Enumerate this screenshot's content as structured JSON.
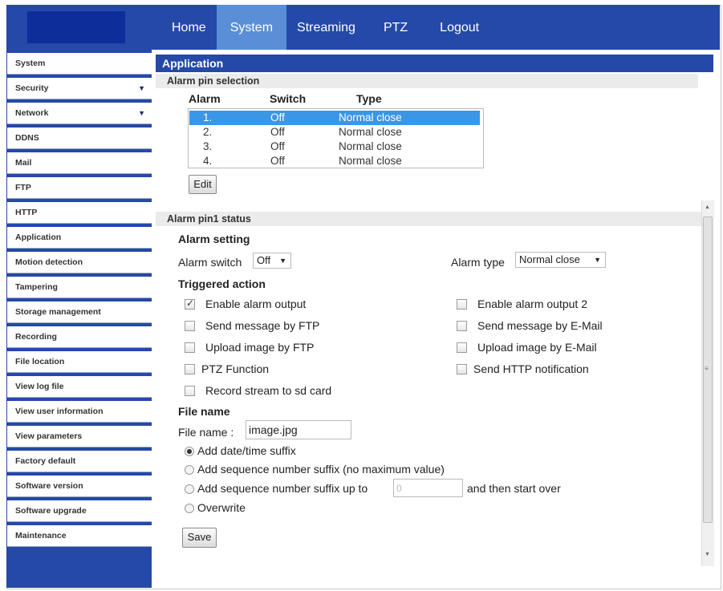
{
  "nav": {
    "items": [
      {
        "label": "Home"
      },
      {
        "label": "System"
      },
      {
        "label": "Streaming"
      },
      {
        "label": "PTZ"
      },
      {
        "label": "Logout"
      }
    ],
    "active": "System"
  },
  "sidebar": {
    "items": [
      {
        "label": "System"
      },
      {
        "label": "Security"
      },
      {
        "label": "Network"
      },
      {
        "label": "DDNS"
      },
      {
        "label": "Mail"
      },
      {
        "label": "FTP"
      },
      {
        "label": "HTTP"
      },
      {
        "label": "Application"
      },
      {
        "label": "Motion detection"
      },
      {
        "label": "Tampering"
      },
      {
        "label": "Storage management"
      },
      {
        "label": "Recording"
      },
      {
        "label": "File location"
      },
      {
        "label": "View log file"
      },
      {
        "label": "View user information"
      },
      {
        "label": "View parameters"
      },
      {
        "label": "Factory default"
      },
      {
        "label": "Software version"
      },
      {
        "label": "Software upgrade"
      },
      {
        "label": "Maintenance"
      }
    ]
  },
  "main": {
    "title": "Application",
    "alarm_pin_selection": {
      "heading": "Alarm pin selection",
      "columns": [
        "Alarm",
        "Switch",
        "Type"
      ],
      "rows": [
        {
          "alarm": "1.",
          "switch": "Off",
          "type": "Normal close"
        },
        {
          "alarm": "2.",
          "switch": "Off",
          "type": "Normal close"
        },
        {
          "alarm": "3.",
          "switch": "Off",
          "type": "Normal close"
        },
        {
          "alarm": "4.",
          "switch": "Off",
          "type": "Normal close"
        }
      ],
      "selected_row": "1.",
      "edit_label": "Edit"
    },
    "status": {
      "heading": "Alarm pin1 status",
      "alarm_setting": "Alarm setting",
      "alarm_switch_label": "Alarm switch",
      "alarm_switch_value": "Off",
      "alarm_type_label": "Alarm type",
      "alarm_type_value": "Normal close",
      "triggered_action": "Triggered action",
      "actions": {
        "enable_alarm_output": {
          "label": "Enable alarm output",
          "checked": true
        },
        "enable_alarm_output_2": {
          "label": "Enable alarm output 2",
          "checked": false
        },
        "send_ftp": {
          "label": "Send message by FTP",
          "checked": false
        },
        "send_email": {
          "label": "Send message by E-Mail",
          "checked": false
        },
        "upload_ftp": {
          "label": "Upload image by FTP",
          "checked": false
        },
        "upload_email": {
          "label": "Upload image by E-Mail",
          "checked": false
        },
        "ptz": {
          "label": "PTZ Function",
          "checked": false
        },
        "http": {
          "label": "Send HTTP notification",
          "checked": false
        },
        "record_sd": {
          "label": "Record stream to sd card",
          "checked": false
        }
      },
      "file_name_heading": "File name",
      "file_name_label": "File name :",
      "file_name_value": "image.jpg",
      "suffix_options": {
        "datetime": "Add date/time suffix",
        "sequence": "Add sequence number suffix (no maximum value)",
        "sequence_upto": "Add sequence number suffix up to",
        "start_over": "and then start over",
        "overwrite": "Overwrite"
      },
      "selected_suffix": "datetime",
      "sequence_max_placeholder": "0",
      "save_label": "Save"
    }
  },
  "colors": {
    "brand_blue": "#2549a8",
    "nav_active": "#5a8fd7",
    "selection": "#3a96e6"
  }
}
